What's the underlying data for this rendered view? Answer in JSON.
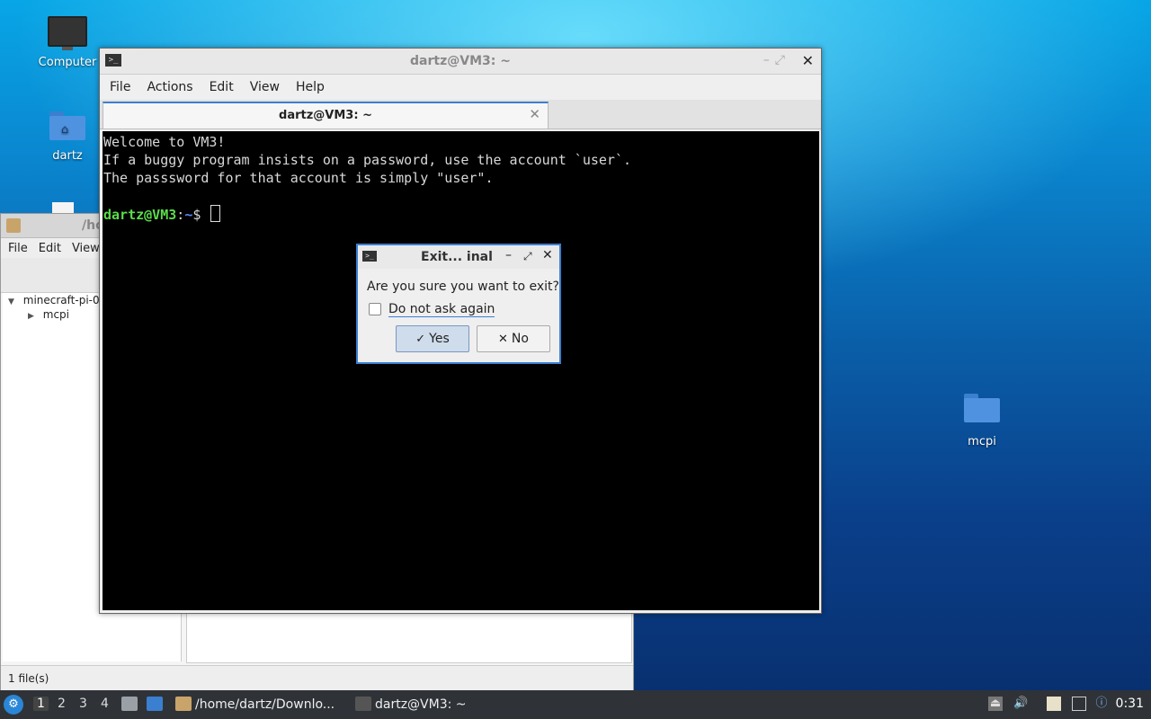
{
  "desktop": {
    "icons": [
      {
        "label": "Computer"
      },
      {
        "label": "dartz"
      },
      {
        "label": "mcpi"
      }
    ]
  },
  "file_manager": {
    "title": "/ho",
    "menu": [
      "File",
      "Edit",
      "View"
    ],
    "tree": [
      {
        "label": "minecraft-pi-0",
        "expanded": true
      },
      {
        "label": "mcpi",
        "expanded": false
      }
    ],
    "status": "1 file(s)"
  },
  "terminal": {
    "title": "dartz@VM3: ~",
    "menu": [
      "File",
      "Actions",
      "Edit",
      "View",
      "Help"
    ],
    "tab_label": "dartz@VM3: ~",
    "lines": [
      "Welcome to VM3!",
      "If a buggy program insists on a password, use the account `user`.",
      "The passsword for that account is simply \"user\"."
    ],
    "prompt": {
      "user": "dartz@VM3",
      "sep": ":",
      "path": "~",
      "symbol": "$ "
    }
  },
  "dialog": {
    "title": "Exit...  inal",
    "question": "Are you sure you want to exit?",
    "checkbox_label": "Do not ask again",
    "checkbox_checked": false,
    "yes_label": "Yes",
    "no_label": "No"
  },
  "taskbar": {
    "workspaces": [
      "1",
      "2",
      "3",
      "4"
    ],
    "active_workspace": "1",
    "tasks": [
      {
        "label": "/home/dartz/Downlo...",
        "icon": "file-manager-icon"
      },
      {
        "label": "dartz@VM3: ~",
        "icon": "terminal-icon"
      }
    ],
    "clock": "0:31"
  }
}
